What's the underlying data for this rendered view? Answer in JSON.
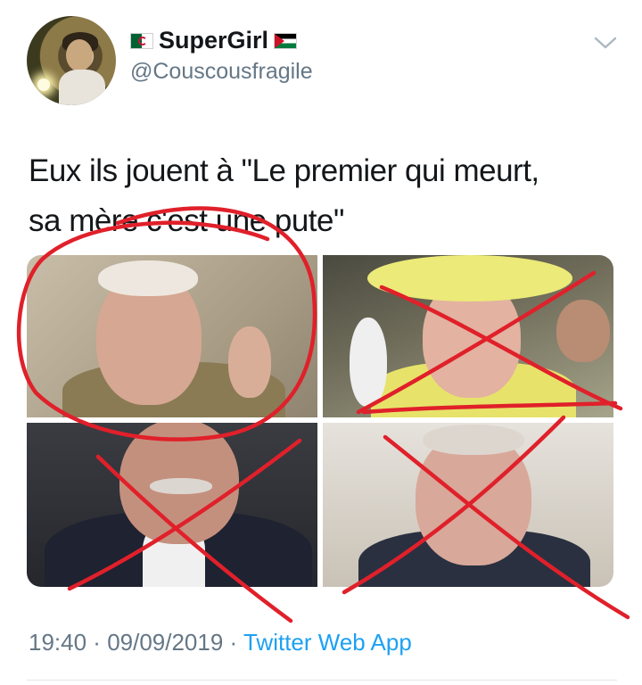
{
  "user": {
    "display_name": "SuperGirl",
    "handle": "@Couscousfragile",
    "flag_left": "algeria-flag",
    "flag_right": "palestine-flag"
  },
  "tweet": {
    "line1": "Eux ils jouent à \"Le premier qui meurt,",
    "line2": "sa mère c'est une pute\""
  },
  "footer": {
    "time": "19:40",
    "sep1": " · ",
    "date": "09/09/2019",
    "sep2": " · ",
    "source": "Twitter Web App"
  },
  "colors": {
    "link": "#1da1f2",
    "muted": "#657786",
    "scribble": "#e0202a"
  },
  "icons": {
    "more": "chevron-down-icon"
  }
}
